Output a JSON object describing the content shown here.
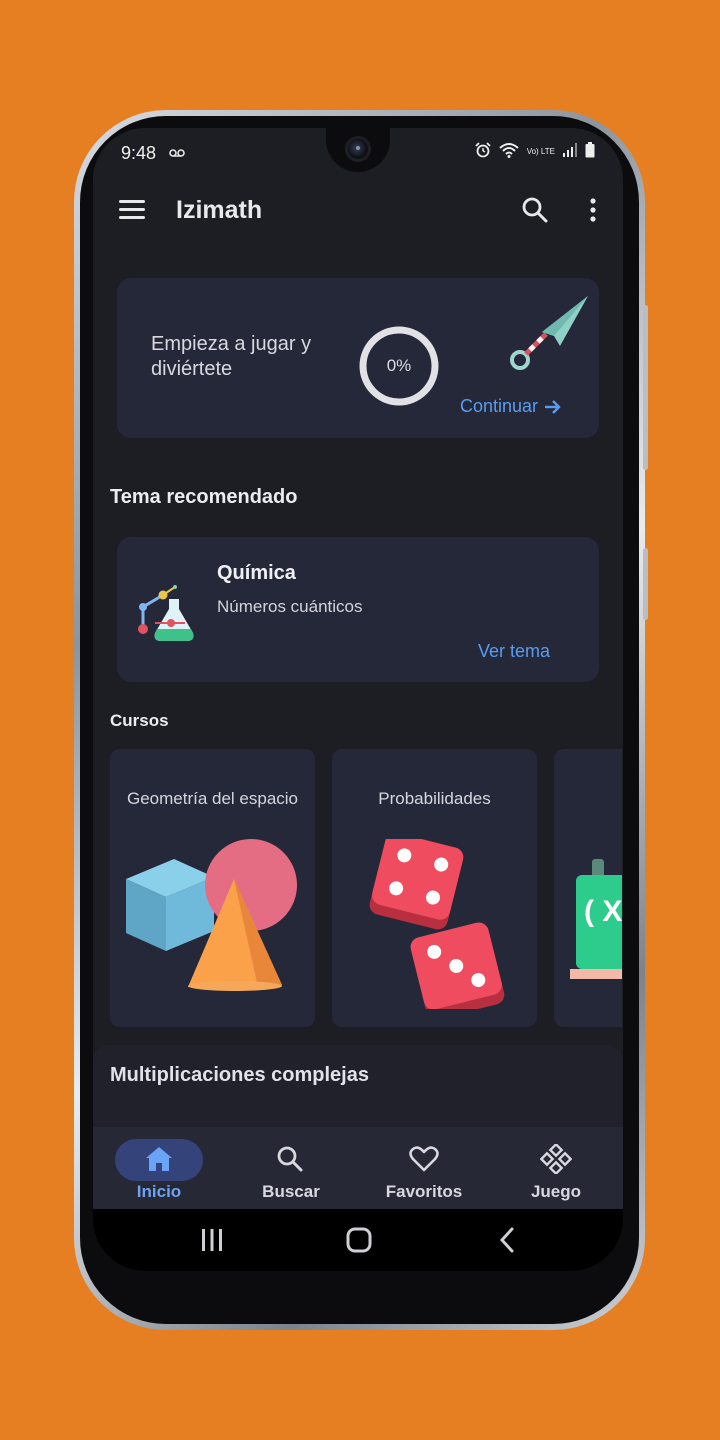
{
  "status_bar": {
    "time": "9:48",
    "voicemail_icon": "voicemail-icon",
    "icons": [
      "alarm-icon",
      "wifi-icon",
      "volte-icon",
      "signal-icon",
      "battery-icon"
    ],
    "volte_text": "Vo) LTE"
  },
  "app_bar": {
    "title": "Izimath",
    "menu_icon": "menu-icon",
    "search_icon": "search-icon",
    "more_icon": "more-vert-icon"
  },
  "progress_card": {
    "message": "Empieza a jugar y diviértete",
    "progress_label": "0%",
    "progress_value": 0,
    "illustration": "kunai-icon",
    "continue_label": "Continuar",
    "continue_icon": "arrow-right-icon"
  },
  "recommended": {
    "section_title": "Tema recomendado",
    "topic_name": "Química",
    "topic_subtitle": "Números cuánticos",
    "icon": "chemistry-flask-icon",
    "link_label": "Ver tema"
  },
  "courses": {
    "section_title": "Cursos",
    "items": [
      {
        "title": "Geometría del espacio",
        "icon": "geometry-shapes-icon"
      },
      {
        "title": "Probabilidades",
        "icon": "dice-icon"
      },
      {
        "title": "",
        "icon": "chalkboard-icon",
        "visible_text": "( X"
      }
    ]
  },
  "next_section": {
    "title": "Multiplicaciones complejas"
  },
  "bottom_nav": {
    "items": [
      {
        "label": "Inicio",
        "icon": "home-icon",
        "active": true
      },
      {
        "label": "Buscar",
        "icon": "search-icon",
        "active": false
      },
      {
        "label": "Favoritos",
        "icon": "heart-icon",
        "active": false
      },
      {
        "label": "Juego",
        "icon": "gamepad-icon",
        "active": false
      }
    ]
  },
  "system_nav": {
    "icons": [
      "recents-icon",
      "home-button-icon",
      "back-icon"
    ]
  },
  "colors": {
    "background": "#E67F22",
    "screen": "#1D1E24",
    "card": "#252838",
    "accent": "#5B9CF0",
    "active_pill": "#34437A"
  }
}
